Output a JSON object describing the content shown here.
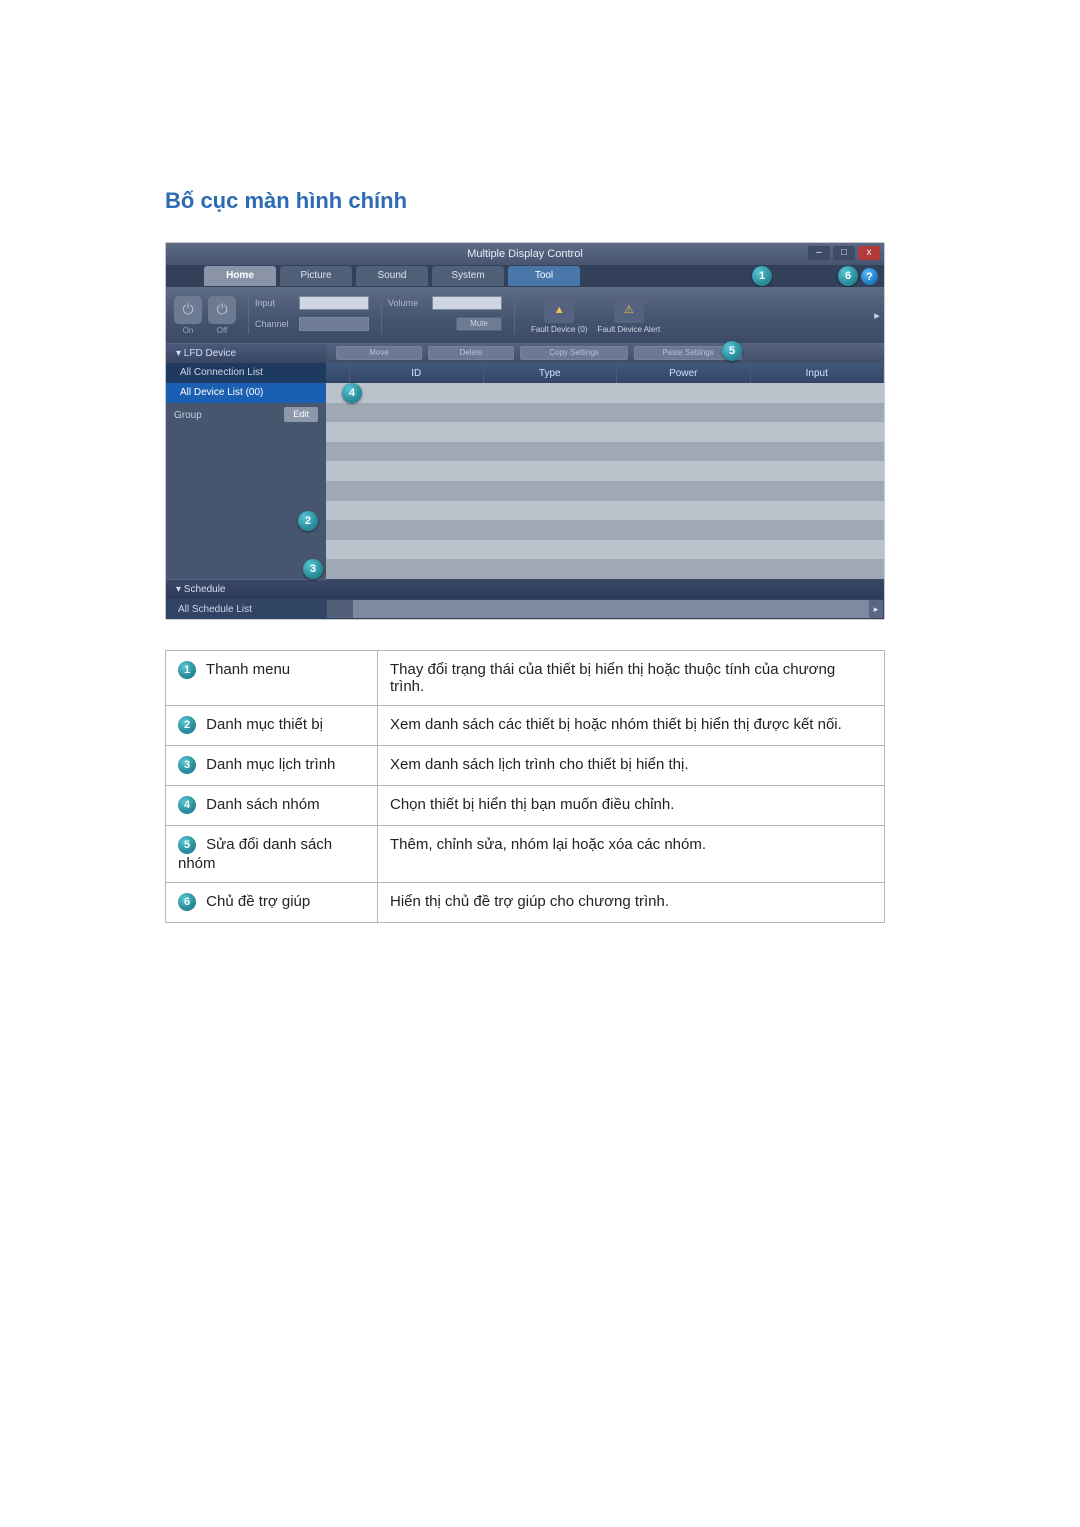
{
  "section_title": "Bố cục màn hình chính",
  "window": {
    "title": "Multiple Display Control",
    "win_min": "–",
    "win_max": "□",
    "win_close": "x",
    "tabs": {
      "home": "Home",
      "picture": "Picture",
      "sound": "Sound",
      "system": "System",
      "tool": "Tool"
    },
    "toolbar": {
      "on": "On",
      "off": "Off",
      "input_label": "Input",
      "channel_label": "Channel",
      "volume_label": "Volume",
      "mute": "Mute",
      "fault_device_count": "Fault Device (0)",
      "fault_device_alert": "Fault Device Alert"
    },
    "left_panel": {
      "lfd_device": "▾  LFD Device",
      "all_connection_list": "All Connection List",
      "all_device_list": "All Device List (00)",
      "group": "Group",
      "edit": "Edit",
      "schedule": "▾  Schedule",
      "all_schedule_list": "All Schedule List"
    },
    "actions": {
      "move": "Move",
      "delete": "Delete",
      "copy_settings": "Copy Settings",
      "paste_settings": "Paste Settings"
    },
    "grid_headers": {
      "id": "ID",
      "type": "Type",
      "power": "Power",
      "input": "Input"
    },
    "help_mark": "?",
    "callouts": {
      "c1": "1",
      "c2": "2",
      "c3": "3",
      "c4": "4",
      "c5": "5",
      "c6": "6"
    },
    "right_arrow": "▸",
    "scroll_right": "▸"
  },
  "table": {
    "rows": [
      {
        "num": "1",
        "label": "Thanh menu",
        "desc": "Thay đổi trạng thái của thiết bị hiển thị hoặc thuộc tính của chương trình."
      },
      {
        "num": "2",
        "label": "Danh mục thiết bị",
        "desc": "Xem danh sách các thiết bị hoặc nhóm thiết bị hiển thị được kết nối."
      },
      {
        "num": "3",
        "label": "Danh mục lịch trình",
        "desc": "Xem danh sách lịch trình cho thiết bị hiển thị."
      },
      {
        "num": "4",
        "label": "Danh sách nhóm",
        "desc": "Chọn thiết bị hiển thị bạn muốn điều chỉnh."
      },
      {
        "num": "5",
        "label": "Sửa đổi danh sách nhóm",
        "desc": "Thêm, chỉnh sửa, nhóm lại hoặc xóa các nhóm."
      },
      {
        "num": "6",
        "label": "Chủ đề trợ giúp",
        "desc": "Hiển thị chủ đề trợ giúp cho chương trình."
      }
    ]
  }
}
